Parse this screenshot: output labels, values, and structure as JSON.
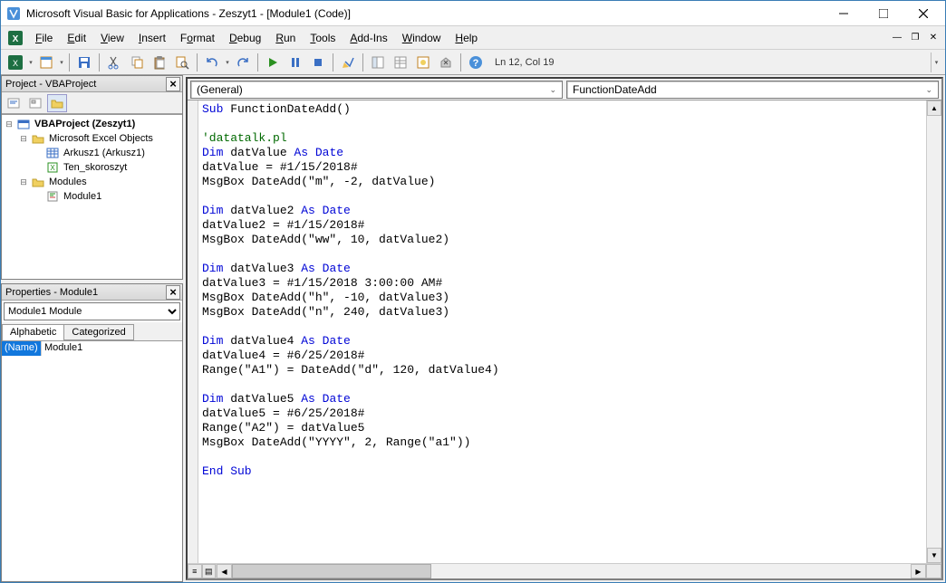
{
  "title": "Microsoft Visual Basic for Applications - Zeszyt1 - [Module1 (Code)]",
  "menus": [
    "File",
    "Edit",
    "View",
    "Insert",
    "Format",
    "Debug",
    "Run",
    "Tools",
    "Add-Ins",
    "Window",
    "Help"
  ],
  "menuAccess": [
    "F",
    "E",
    "V",
    "I",
    "o",
    "D",
    "R",
    "T",
    "A",
    "W",
    "H"
  ],
  "cursor": "Ln 12, Col 19",
  "project": {
    "paneTitle": "Project - VBAProject",
    "root": "VBAProject (Zeszyt1)",
    "excelObjects": "Microsoft Excel Objects",
    "sheet": "Arkusz1 (Arkusz1)",
    "workbook": "Ten_skoroszyt",
    "modulesFolder": "Modules",
    "module": "Module1"
  },
  "properties": {
    "paneTitle": "Properties - Module1",
    "objectSel": "Module1 Module",
    "tabs": [
      "Alphabetic",
      "Categorized"
    ],
    "nameLabel": "(Name)",
    "nameValue": "Module1"
  },
  "selectors": {
    "left": "(General)",
    "right": "FunctionDateAdd"
  },
  "code": [
    {
      "t": "kw",
      "s": "Sub "
    },
    {
      "t": "p",
      "s": "FunctionDateAdd()"
    },
    {
      "t": "br"
    },
    {
      "t": "br"
    },
    {
      "t": "cm",
      "s": "'datatalk.pl"
    },
    {
      "t": "br"
    },
    {
      "t": "kw",
      "s": "Dim "
    },
    {
      "t": "p",
      "s": "datValue "
    },
    {
      "t": "kw",
      "s": "As Date"
    },
    {
      "t": "br"
    },
    {
      "t": "p",
      "s": "datValue = #1/15/2018#"
    },
    {
      "t": "br"
    },
    {
      "t": "p",
      "s": "MsgBox DateAdd(\"m\", -2, datValue)"
    },
    {
      "t": "br"
    },
    {
      "t": "br"
    },
    {
      "t": "kw",
      "s": "Dim "
    },
    {
      "t": "p",
      "s": "datValue2 "
    },
    {
      "t": "kw",
      "s": "As Date"
    },
    {
      "t": "br"
    },
    {
      "t": "p",
      "s": "datValue2 = #1/15/2018#"
    },
    {
      "t": "br"
    },
    {
      "t": "p",
      "s": "MsgBox DateAdd(\"ww\", 10, datValue2)"
    },
    {
      "t": "br"
    },
    {
      "t": "br"
    },
    {
      "t": "kw",
      "s": "Dim "
    },
    {
      "t": "p",
      "s": "datValue3 "
    },
    {
      "t": "kw",
      "s": "As Date"
    },
    {
      "t": "br"
    },
    {
      "t": "p",
      "s": "datValue3 = #1/15/2018 3:00:00 AM#"
    },
    {
      "t": "br"
    },
    {
      "t": "p",
      "s": "MsgBox DateAdd(\"h\", -10, datValue3)"
    },
    {
      "t": "br"
    },
    {
      "t": "p",
      "s": "MsgBox DateAdd(\"n\", 240, datValue3)"
    },
    {
      "t": "br"
    },
    {
      "t": "br"
    },
    {
      "t": "kw",
      "s": "Dim "
    },
    {
      "t": "p",
      "s": "datValue4 "
    },
    {
      "t": "kw",
      "s": "As Date"
    },
    {
      "t": "br"
    },
    {
      "t": "p",
      "s": "datValue4 = #6/25/2018#"
    },
    {
      "t": "br"
    },
    {
      "t": "p",
      "s": "Range(\"A1\") = DateAdd(\"d\", 120, datValue4)"
    },
    {
      "t": "br"
    },
    {
      "t": "br"
    },
    {
      "t": "kw",
      "s": "Dim "
    },
    {
      "t": "p",
      "s": "datValue5 "
    },
    {
      "t": "kw",
      "s": "As Date"
    },
    {
      "t": "br"
    },
    {
      "t": "p",
      "s": "datValue5 = #6/25/2018#"
    },
    {
      "t": "br"
    },
    {
      "t": "p",
      "s": "Range(\"A2\") = datValue5"
    },
    {
      "t": "br"
    },
    {
      "t": "p",
      "s": "MsgBox DateAdd(\"YYYY\", 2, Range(\"a1\"))"
    },
    {
      "t": "br"
    },
    {
      "t": "br"
    },
    {
      "t": "kw",
      "s": "End Sub"
    },
    {
      "t": "br"
    }
  ]
}
